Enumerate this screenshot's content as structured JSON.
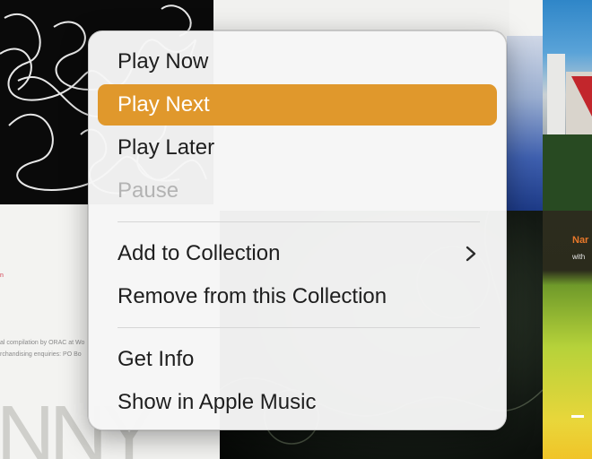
{
  "background": {
    "left_caption_1": "al compilation by ORAC at Wo",
    "left_caption_2": "rchandising enquiries: PO Bo",
    "right_title": "Nar",
    "right_subtitle": "with",
    "big_letters": "NNY"
  },
  "menu": {
    "items": [
      {
        "label": "Play Now"
      },
      {
        "label": "Play Next"
      },
      {
        "label": "Play Later"
      },
      {
        "label": "Pause"
      },
      {
        "label": "Add to Collection"
      },
      {
        "label": "Remove from this Collection"
      },
      {
        "label": "Get Info"
      },
      {
        "label": "Show in Apple Music"
      }
    ],
    "selected_index": 1,
    "disabled_index": 3,
    "submenu_icon": "chevron-right-icon",
    "highlight_color": "#e0982c"
  }
}
